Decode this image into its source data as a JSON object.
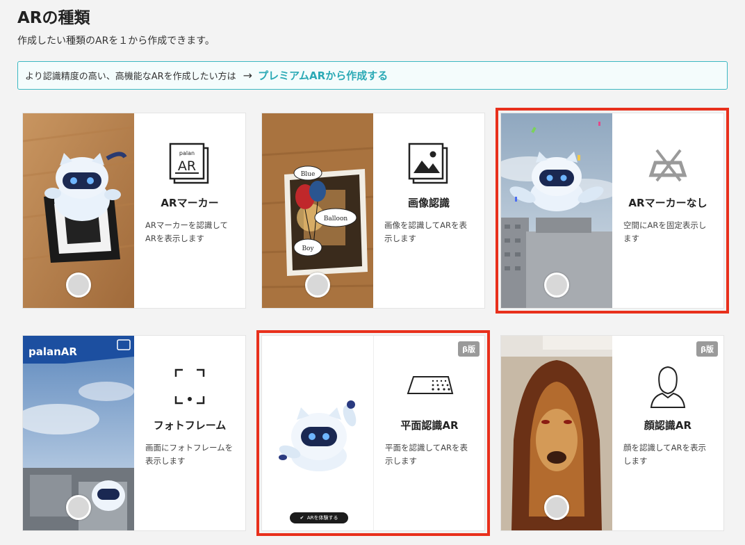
{
  "page": {
    "title": "ARの種類",
    "subtitle": "作成したい種類のARを１から作成できます。",
    "premium_text": "より認識精度の高い、高機能なARを作成したい方は",
    "premium_arrow": "→",
    "premium_link": "プレミアムARから作成する"
  },
  "cards": [
    {
      "name": "ARマーカー",
      "desc": "ARマーカーを認識してARを表示します",
      "icon": "ar-marker-icon",
      "icon_text_top": "palan",
      "icon_text_main": "AR",
      "selected": false
    },
    {
      "name": "画像認識",
      "desc": "画像を認識してARを表示します",
      "icon": "image-icon",
      "photo_labels": [
        "Blue",
        "Balloon",
        "Boy"
      ],
      "selected": false
    },
    {
      "name": "ARマーカーなし",
      "desc": "空間にARを固定表示します",
      "icon": "no-marker-icon",
      "selected": true
    },
    {
      "name": "フォトフレーム",
      "desc": "画面にフォトフレームを表示します",
      "icon": "photo-frame-icon",
      "frame_logo": "palanAR",
      "selected": false
    },
    {
      "name": "平面認識AR",
      "desc": "平面を認識してARを表示します",
      "icon": "plane-icon",
      "beta": "β版",
      "try_label": "ARを体験する",
      "selected": true
    },
    {
      "name": "顔認識AR",
      "desc": "顔を認識してARを表示します",
      "icon": "face-icon",
      "beta": "β版",
      "selected": false
    }
  ]
}
